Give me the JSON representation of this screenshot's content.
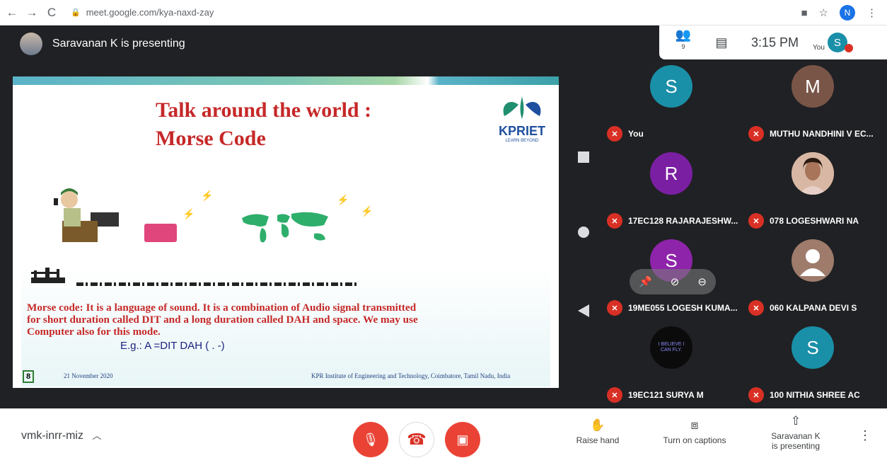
{
  "browser": {
    "url": "meet.google.com/kya-naxd-zay",
    "profile_initial": "N"
  },
  "presenter": {
    "text": "Saravanan K is presenting"
  },
  "top_panel": {
    "people_count": "9",
    "time": "3:15 PM",
    "you_label": "You",
    "you_initial": "S"
  },
  "slide": {
    "title_line1": "Talk around the world :",
    "title_line2": "Morse Code",
    "logo_text": "KPRIET",
    "logo_sub": "LEARN BEYOND",
    "body": "Morse code: It is a language of sound. It is a combination of Audio signal transmitted for short duration called DIT and a long duration called DAH and space. We may use Computer also for this mode.",
    "example": "E.g.: A  =DIT DAH ( . -)",
    "page_number": "8",
    "date": "21 November 2020",
    "footer": "KPR Institute of Engineering and Technology, Coimbatore, Tamil Nadu, India"
  },
  "participants": [
    {
      "name": "You",
      "initial": "S",
      "color": "#1a8fa8",
      "type": "initial"
    },
    {
      "name": "MUTHU NANDHINI V EC...",
      "initial": "M",
      "color": "#795548",
      "type": "initial"
    },
    {
      "name": "17EC128 RAJARAJESHW...",
      "initial": "R",
      "color": "#7b1fa2",
      "type": "initial"
    },
    {
      "name": "078 LOGESHWARI NA",
      "initial": "",
      "color": "#c9a48f",
      "type": "photo"
    },
    {
      "name": "19ME055 LOGESH KUMA...",
      "initial": "S",
      "color": "#8e24aa",
      "type": "initial"
    },
    {
      "name": "060 KALPANA DEVI S",
      "initial": "",
      "color": "#9e7b6b",
      "type": "silhouette"
    },
    {
      "name": "19EC121 SURYA M",
      "initial": "I BELIEVE I CAN FLY.",
      "color": "#0b0b0b",
      "type": "text"
    },
    {
      "name": "100 NITHIA SHREE AC",
      "initial": "S",
      "color": "#1a8fa8",
      "type": "initial"
    }
  ],
  "bottom_bar": {
    "meeting_code": "vmk-inrr-miz",
    "raise_hand": "Raise hand",
    "captions": "Turn on captions",
    "presenting_line1": "Saravanan K",
    "presenting_line2": "is presenting"
  },
  "colors": {
    "end_call": "#ea4335",
    "muted": "#d93025",
    "meet_bg": "#202124"
  }
}
